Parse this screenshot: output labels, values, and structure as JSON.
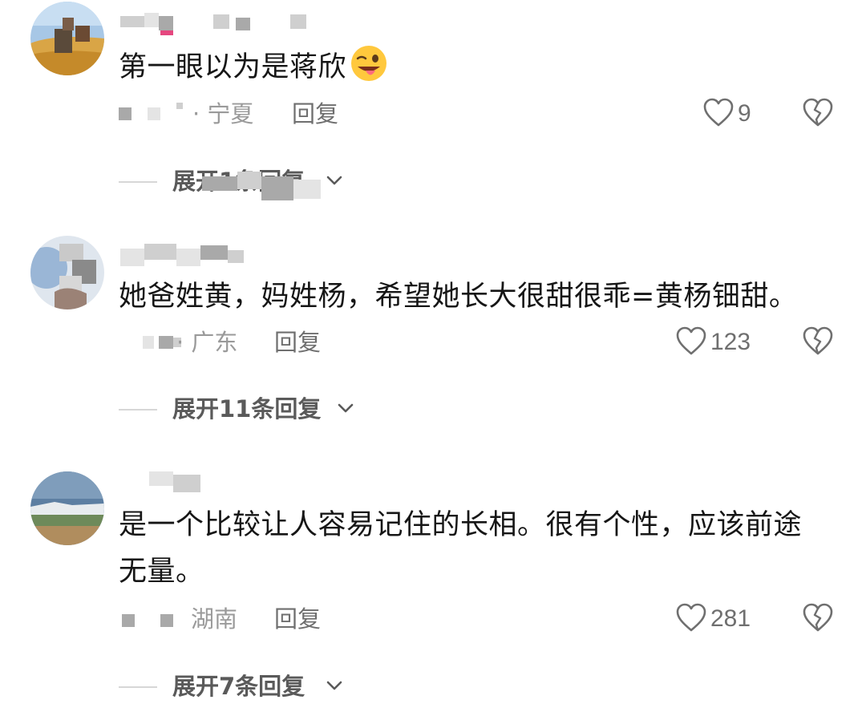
{
  "comments": [
    {
      "text": "第一眼以为是蒋欣",
      "emoji": "winking-tongue-emoji",
      "location": "· 宁夏",
      "reply_label": "回复",
      "likes": "9",
      "expand_label": "展开1条回复"
    },
    {
      "text": "她爸姓黄，妈姓杨，希望她长大很甜很乖=黄杨钿甜。",
      "location": "· 广东",
      "reply_label": "回复",
      "likes": "123",
      "expand_label": "展开11条回复"
    },
    {
      "text": "是一个比较让人容易记住的长相。很有个性，应该前途无量。",
      "location": "湖南",
      "reply_label": "回复",
      "likes": "281",
      "expand_label": "展开7条回复"
    }
  ],
  "icons": {
    "like": "heart-outline-icon",
    "dislike": "broken-heart-icon",
    "expand": "chevron-down-icon"
  },
  "colors": {
    "text": "#161616",
    "secondary": "#6f6f6f",
    "location": "#9a9a9a"
  }
}
